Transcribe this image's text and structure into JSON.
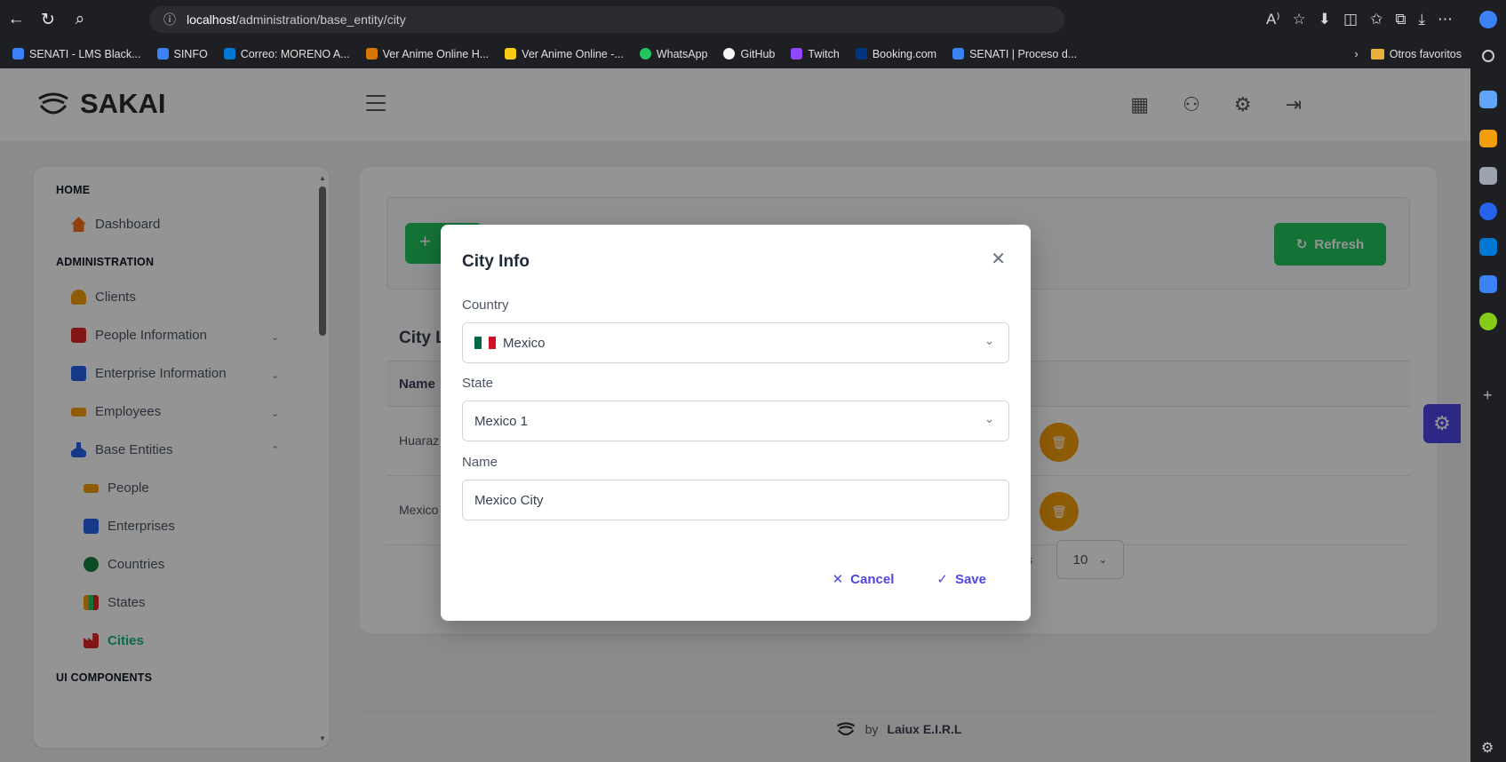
{
  "browser": {
    "url_host": "localhost",
    "url_path": "/administration/base_entity/city",
    "bookmarks": [
      "SENATI - LMS Black...",
      "SINFO",
      "Correo: MORENO A...",
      "Ver Anime Online H...",
      "Ver Anime Online -...",
      "WhatsApp",
      "GitHub",
      "Twitch",
      "Booking.com",
      "SENATI | Proceso d..."
    ],
    "other_favorites": "Otros favoritos"
  },
  "app": {
    "brand": "SAKAI"
  },
  "sidebar": {
    "section_home": "HOME",
    "dashboard": "Dashboard",
    "section_admin": "ADMINISTRATION",
    "clients": "Clients",
    "people_information": "People Information",
    "enterprise_information": "Enterprise Information",
    "employees": "Employees",
    "base_entities": "Base Entities",
    "people": "People",
    "enterprises": "Enterprises",
    "countries": "Countries",
    "states": "States",
    "cities": "Cities",
    "section_ui": "UI COMPONENTS"
  },
  "toolbar": {
    "new_symbol": "+",
    "refresh_label": "Refresh"
  },
  "table": {
    "title": "City L",
    "name_header": "Name",
    "rows": [
      "Huaraz",
      "Mexico"
    ],
    "rows_per_page_label": "s",
    "rows_per_page_value": "10"
  },
  "footer": {
    "prefix": "by",
    "company": "Laiux E.I.R.L"
  },
  "dialog": {
    "title": "City Info",
    "country_label": "Country",
    "country_value": "Mexico",
    "state_label": "State",
    "state_value": "Mexico 1",
    "name_label": "Name",
    "name_value": "Mexico City",
    "cancel_label": "Cancel",
    "save_label": "Save"
  },
  "colors": {
    "accent_green": "#22c55e",
    "primary": "#4f46e5",
    "warning": "#f59e0b"
  }
}
